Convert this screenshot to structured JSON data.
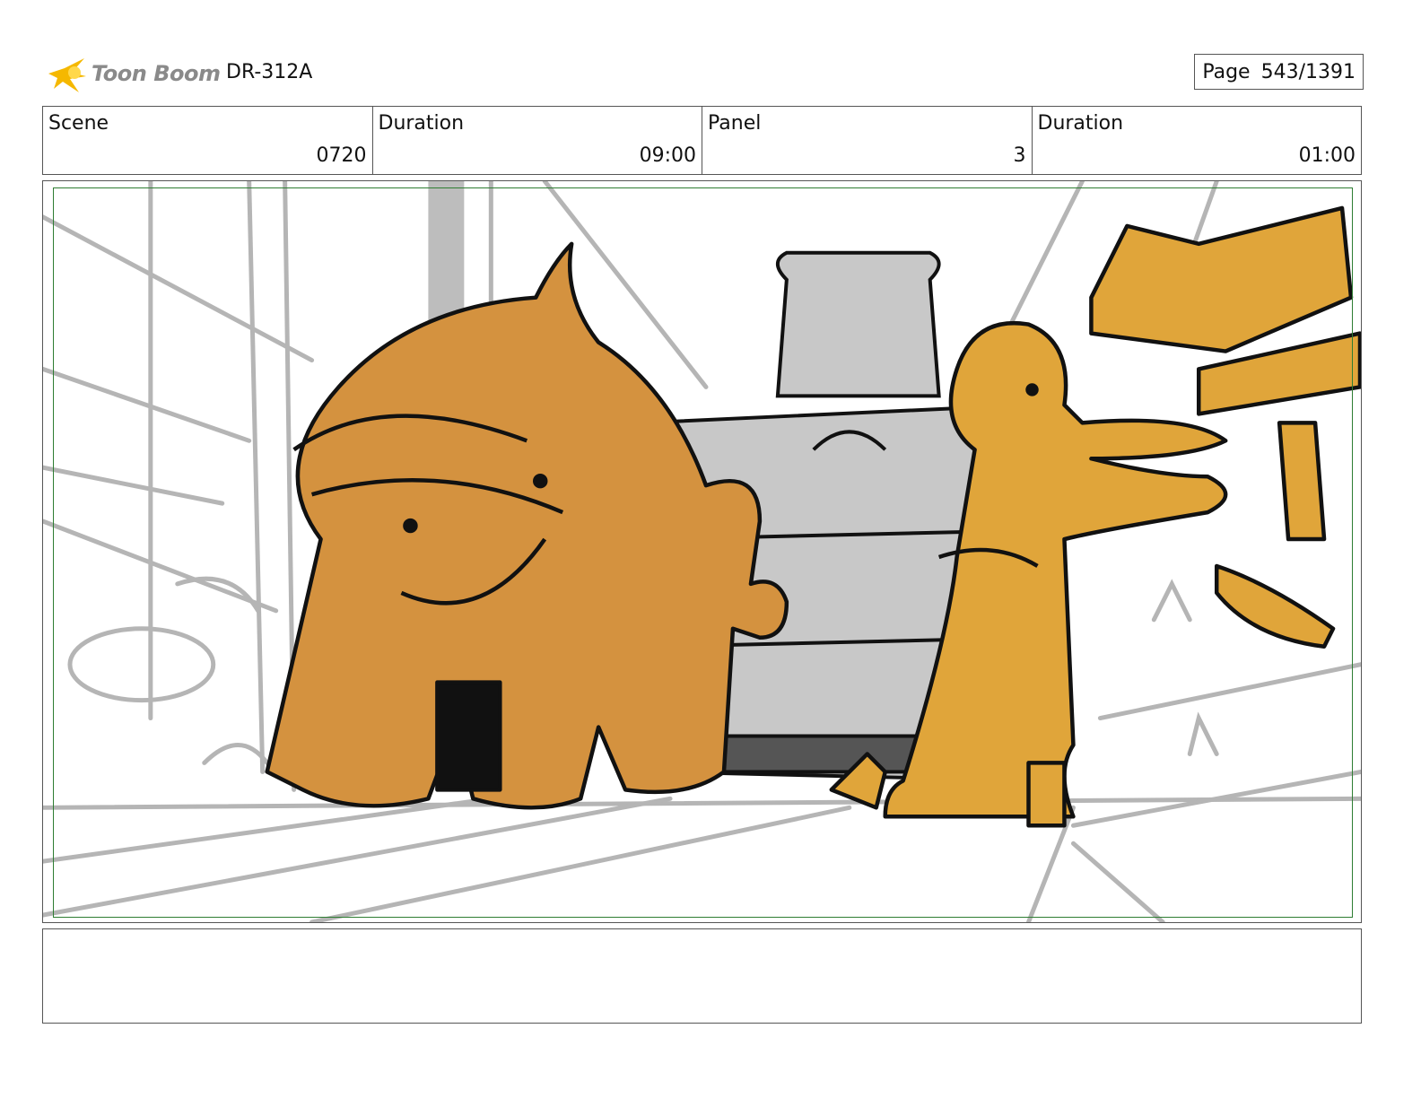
{
  "header": {
    "logo_text": "Toon Boom",
    "doc_id": "DR-312A",
    "page_label": "Page",
    "page_value": "543/1391"
  },
  "info": {
    "scene_label": "Scene",
    "scene_value": "0720",
    "scene_duration_label": "Duration",
    "scene_duration_value": "09:00",
    "panel_label": "Panel",
    "panel_value": "3",
    "panel_duration_label": "Duration",
    "panel_duration_value": "01:00"
  },
  "colors": {
    "creature_fill": "#d4923f",
    "character_fill": "#e0a53a",
    "machine_fill": "#c8c8c8",
    "background_lines": "#b5b5b5",
    "safe_frame": "#2e7d32"
  },
  "notes": {
    "text": ""
  }
}
